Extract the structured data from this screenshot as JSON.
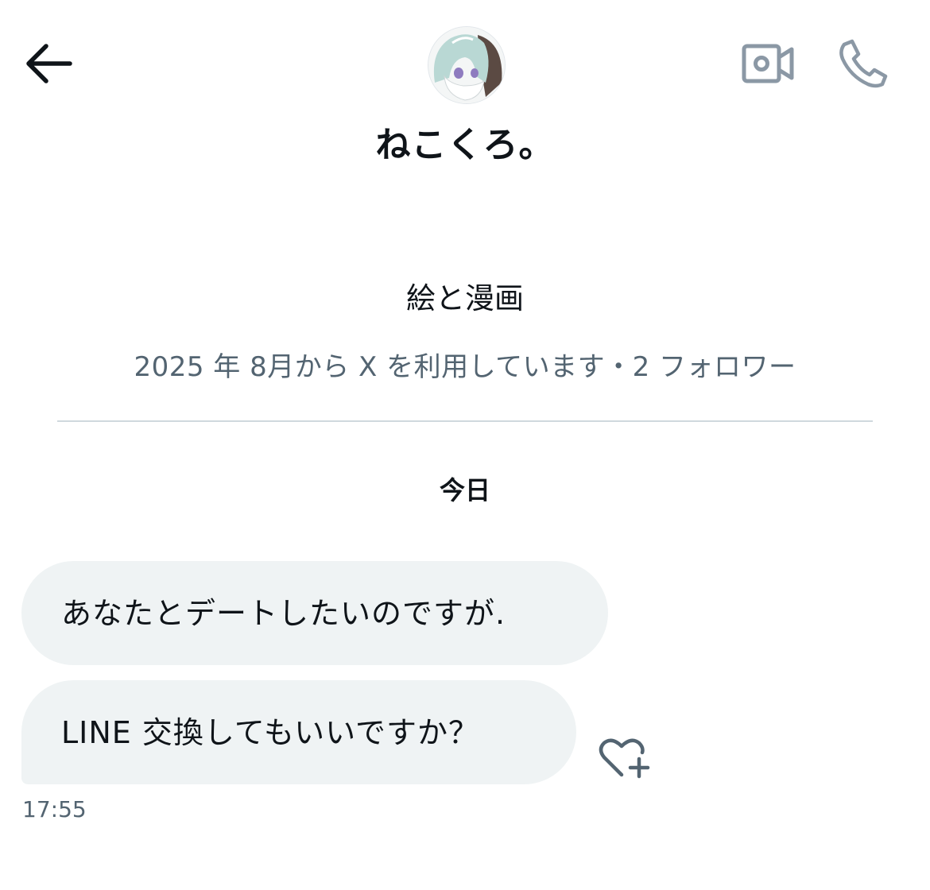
{
  "header": {
    "back_icon": "arrow-left-icon",
    "video_icon": "video-camera-icon",
    "call_icon": "phone-icon",
    "avatar_icon": "anime-character-avatar",
    "display_name": "ねこくろ。"
  },
  "profile": {
    "bio": "絵と漫画",
    "meta": "2025 年 8月から X を利用しています・2 フォロワー"
  },
  "conversation": {
    "date_label": "今日",
    "messages": [
      {
        "text": "あなたとデートしたいのですが."
      },
      {
        "text": "LINE 交換してもいいですか？"
      }
    ],
    "last_timestamp": "17:55",
    "reaction_icon": "heart-plus-icon"
  },
  "colors": {
    "text_primary": "#0f1419",
    "text_secondary": "#536471",
    "bubble_bg": "#eff3f4",
    "divider": "#cfd9de",
    "icon_gray": "#8b98a5"
  }
}
